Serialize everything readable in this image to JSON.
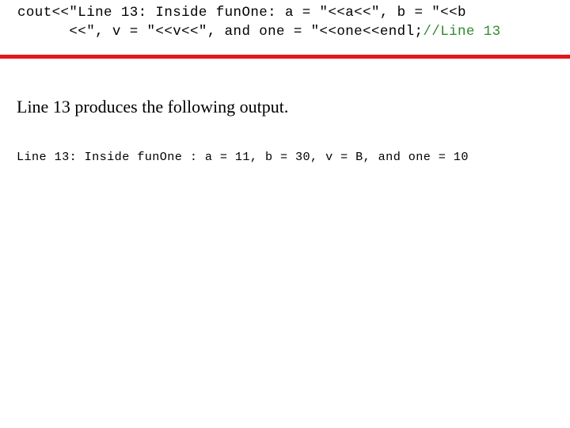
{
  "code_block": {
    "line1": "cout<<\"Line 13: Inside funOne: a = \"<<a<<\", b = \"<<b",
    "line2_code": "      <<\", v = \"<<v<<\", and one = \"<<one<<endl;",
    "line2_comment": "//Line 13"
  },
  "colors": {
    "divider": "#e3161b",
    "comment": "#2e8b2e"
  },
  "description": "Line 13 produces the following output.",
  "output_line": "Line 13: Inside funOne : a = 11, b = 30, v = B, and one = 10"
}
